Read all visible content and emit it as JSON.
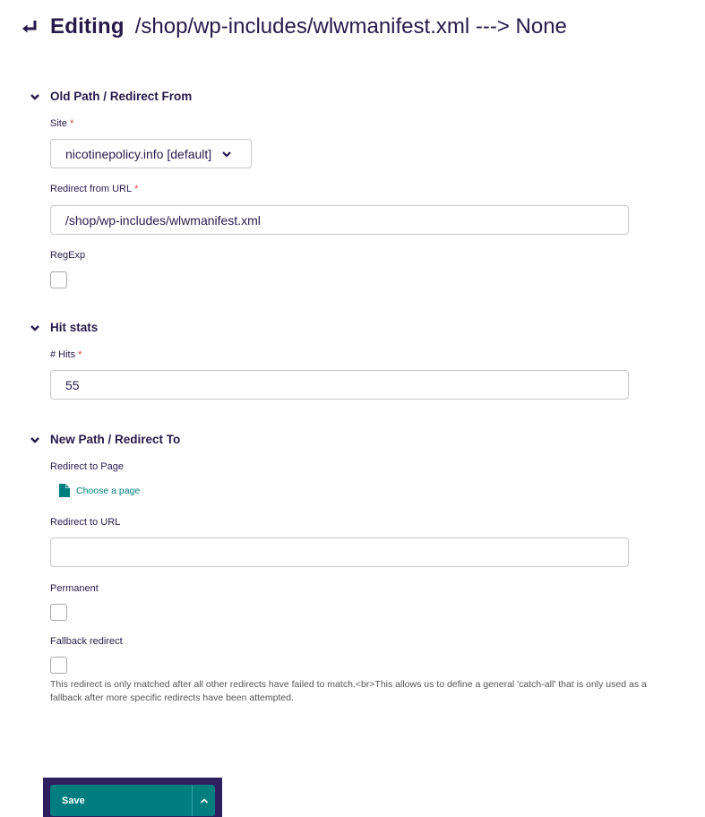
{
  "header": {
    "back_icon": "return-arrow-icon",
    "editing_label": "Editing",
    "subtitle": "/shop/wp-includes/wlwmanifest.xml ---> None"
  },
  "sections": {
    "old_path": {
      "title": "Old Path / Redirect From",
      "site_label": "Site",
      "site_required": "*",
      "site_value": "nicotinepolicy.info [default]",
      "redirect_from_label": "Redirect from URL",
      "redirect_from_required": "*",
      "redirect_from_value": "/shop/wp-includes/wlwmanifest.xml",
      "regexp_label": "RegExp",
      "regexp_checked": false
    },
    "hit_stats": {
      "title": "Hit stats",
      "hits_label": "# Hits",
      "hits_required": "*",
      "hits_value": "55"
    },
    "new_path": {
      "title": "New Path / Redirect To",
      "redirect_page_label": "Redirect to Page",
      "choose_page_label": "Choose a page",
      "redirect_url_label": "Redirect to URL",
      "redirect_url_value": "",
      "permanent_label": "Permanent",
      "permanent_checked": false,
      "fallback_label": "Fallback redirect",
      "fallback_checked": false,
      "fallback_help": "This redirect is only matched after all other redirects have failed to match.<br>This allows us to define a general 'catch-all' that is only used as a fallback after more specific redirects have been attempted."
    }
  },
  "footer": {
    "save_label": "Save",
    "more_actions_icon": "chevron-up-icon"
  },
  "colors": {
    "primary_text": "#261a4a",
    "accent": "#007d7e",
    "footer_bg": "#2e1f5e",
    "required": "#cd4444"
  }
}
